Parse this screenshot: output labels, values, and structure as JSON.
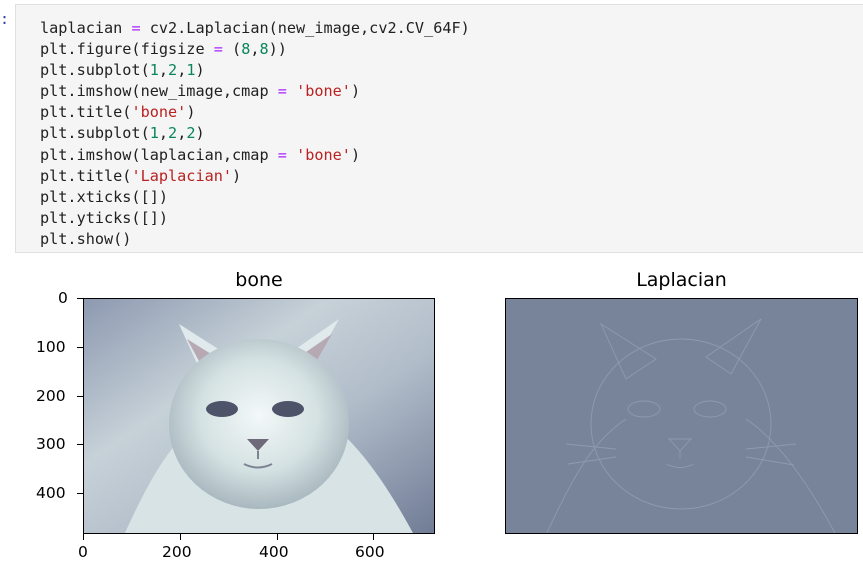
{
  "cell": {
    "prompt": ":",
    "lines": [
      [
        {
          "t": "laplacian "
        },
        {
          "t": "=",
          "c": "kw"
        },
        {
          "t": " cv2.Laplacian(new_image,cv2.CV_64F)"
        }
      ],
      [
        {
          "t": "plt.figure(figsize "
        },
        {
          "t": "=",
          "c": "kw"
        },
        {
          "t": " ("
        },
        {
          "t": "8",
          "c": "num"
        },
        {
          "t": ","
        },
        {
          "t": "8",
          "c": "num"
        },
        {
          "t": "))"
        }
      ],
      [
        {
          "t": "plt.subplot("
        },
        {
          "t": "1",
          "c": "num"
        },
        {
          "t": ","
        },
        {
          "t": "2",
          "c": "num"
        },
        {
          "t": ","
        },
        {
          "t": "1",
          "c": "num"
        },
        {
          "t": ")"
        }
      ],
      [
        {
          "t": "plt.imshow(new_image,cmap "
        },
        {
          "t": "=",
          "c": "kw"
        },
        {
          "t": " "
        },
        {
          "t": "'bone'",
          "c": "str"
        },
        {
          "t": ")"
        }
      ],
      [
        {
          "t": "plt.title("
        },
        {
          "t": "'bone'",
          "c": "str"
        },
        {
          "t": ")"
        }
      ],
      [
        {
          "t": "plt.subplot("
        },
        {
          "t": "1",
          "c": "num"
        },
        {
          "t": ","
        },
        {
          "t": "2",
          "c": "num"
        },
        {
          "t": ","
        },
        {
          "t": "2",
          "c": "num"
        },
        {
          "t": ")"
        }
      ],
      [
        {
          "t": "plt.imshow(laplacian,cmap "
        },
        {
          "t": "=",
          "c": "kw"
        },
        {
          "t": " "
        },
        {
          "t": "'bone'",
          "c": "str"
        },
        {
          "t": ")"
        }
      ],
      [
        {
          "t": "plt.title("
        },
        {
          "t": "'Laplacian'",
          "c": "str"
        },
        {
          "t": ")"
        }
      ],
      [
        {
          "t": "plt.xticks([])"
        }
      ],
      [
        {
          "t": "plt.yticks([])"
        }
      ],
      [
        {
          "t": "plt.show()"
        }
      ]
    ]
  },
  "figure": {
    "left": {
      "title": "bone",
      "image": "cat photo rendered with bone colormap",
      "yticks": [
        "0",
        "100",
        "200",
        "300",
        "400"
      ],
      "xticks": [
        "0",
        "200",
        "400",
        "600"
      ]
    },
    "right": {
      "title": "Laplacian",
      "image": "Laplacian edge map of cat, bone colormap"
    }
  }
}
